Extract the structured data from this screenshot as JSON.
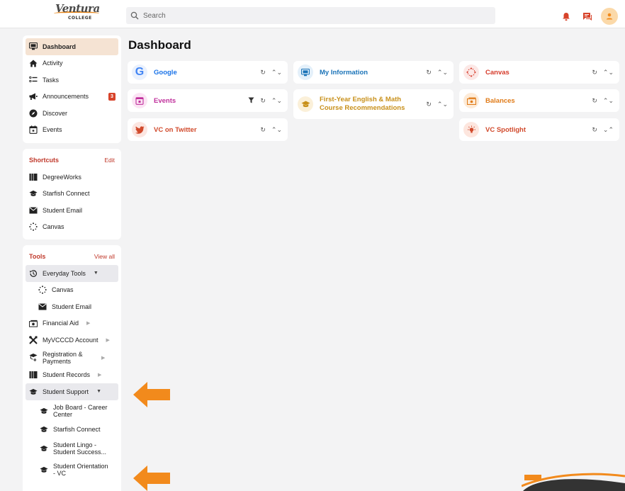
{
  "header": {
    "logo_script": "Ventura",
    "logo_college": "COLLEGE",
    "search_placeholder": "Search"
  },
  "nav": {
    "items": [
      {
        "label": "Dashboard",
        "icon": "monitor-icon"
      },
      {
        "label": "Activity",
        "icon": "home-icon"
      },
      {
        "label": "Tasks",
        "icon": "checklist-icon"
      },
      {
        "label": "Announcements",
        "icon": "megaphone-icon",
        "badge": "3"
      },
      {
        "label": "Discover",
        "icon": "compass-icon"
      },
      {
        "label": "Events",
        "icon": "calendar-icon"
      }
    ]
  },
  "shortcuts": {
    "title": "Shortcuts",
    "edit_label": "Edit",
    "items": [
      {
        "label": "DegreeWorks"
      },
      {
        "label": "Starfish Connect"
      },
      {
        "label": "Student Email"
      },
      {
        "label": "Canvas"
      }
    ]
  },
  "tools": {
    "title": "Tools",
    "view_all_label": "View all",
    "items": [
      {
        "label": "Everyday Tools"
      },
      {
        "label": "Canvas"
      },
      {
        "label": "Student Email"
      },
      {
        "label": "Financial Aid"
      },
      {
        "label": "MyVCCCD Account"
      },
      {
        "label": "Registration & Payments"
      },
      {
        "label": "Student Records"
      },
      {
        "label": "Student Support"
      },
      {
        "label": "Job Board - Career Center"
      },
      {
        "label": "Starfish Connect"
      },
      {
        "label": "Student Lingo - Student Success..."
      },
      {
        "label": "Student Orientation - VC"
      }
    ]
  },
  "main": {
    "title": "Dashboard",
    "cards": [
      {
        "title": "Google",
        "color": "#4285f4"
      },
      {
        "title": "My Information",
        "color": "#1a73b8"
      },
      {
        "title": "Canvas",
        "color": "#d63b2a"
      },
      {
        "title": "Events",
        "color": "#c0309c"
      },
      {
        "title": "First-Year English & Math Course Recommendations",
        "color": "#c8901a"
      },
      {
        "title": "Balances",
        "color": "#e07b18"
      },
      {
        "title": "VC on Twitter",
        "color": "#d14a2c"
      },
      {
        "title": "VC Spotlight",
        "color": "#d14a2c"
      }
    ]
  },
  "colors": {
    "accent": "#c0392b",
    "orange": "#f28a1c",
    "active_bg": "#f5e3d3"
  }
}
